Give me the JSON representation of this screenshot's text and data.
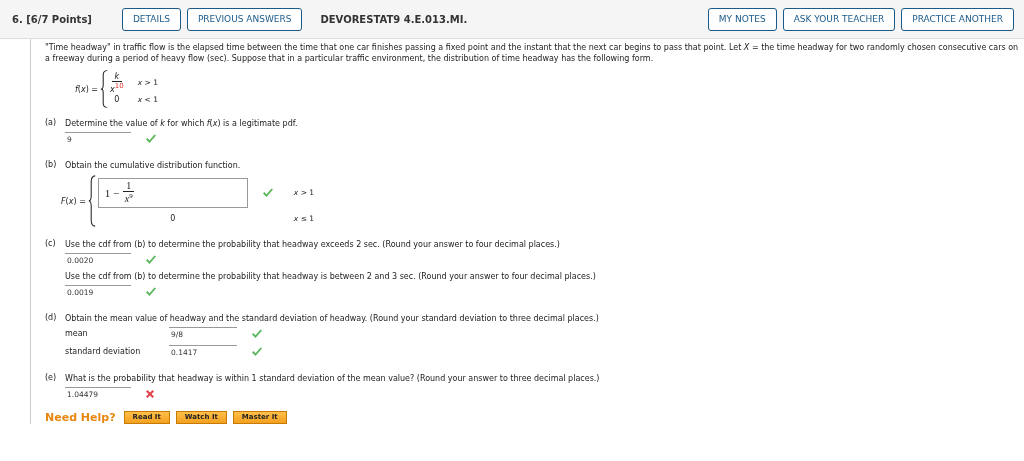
{
  "header": {
    "number": "6.",
    "points": "[6/7 Points]",
    "left_buttons": [
      "DETAILS",
      "PREVIOUS ANSWERS"
    ],
    "code": "DEVORESTAT9 4.E.013.MI.",
    "right_buttons": [
      "MY NOTES",
      "ASK YOUR TEACHER",
      "PRACTICE ANOTHER"
    ]
  },
  "intro": "\"Time headway\" in traffic flow is the elapsed time between the time that one car finishes passing a fixed point and the instant that the next car begins to pass that point. Let *X* = the time headway for two randomly chosen consecutive cars on a freeway during a period of heavy flow (sec). Suppose that in a particular traffic environment, the distribution of time headway has the following form.",
  "pdf": {
    "name": "*f*(*x*) =",
    "cases": [
      {
        "kind": "fraction",
        "numerator": "k",
        "base": "x",
        "exponent": "10",
        "condition": "*x* > 1"
      },
      {
        "kind": "value",
        "value": "0",
        "condition": "*x* < 1"
      }
    ]
  },
  "parts": [
    {
      "label": "(a)",
      "items": [
        {
          "kind": "question",
          "prompt": "Determine the value of *k* for which *f*(*x*) is a legitimate pdf.",
          "answers": [
            {
              "value": "9",
              "correct": true
            }
          ]
        }
      ]
    },
    {
      "label": "(b)",
      "items": [
        {
          "kind": "question",
          "prompt": "Obtain the cumulative distribution function."
        },
        {
          "kind": "cdf",
          "name": "*F*(*x*) =",
          "cases": [
            {
              "kind": "answer",
              "lead": "1 −",
              "numerator": "1",
              "base": "x",
              "exponent": "9",
              "condition": "*x* > 1",
              "correct": true
            },
            {
              "kind": "value",
              "value": "0",
              "condition": "*x* ≤ 1"
            }
          ]
        }
      ]
    },
    {
      "label": "(c)",
      "items": [
        {
          "kind": "question",
          "prompt": "Use the cdf from (b) to determine the probability that headway exceeds 2 sec. (Round your answer to four decimal places.)",
          "answers": [
            {
              "value": "0.0020",
              "correct": true
            }
          ]
        },
        {
          "kind": "question",
          "prompt": "Use the cdf from (b) to determine the probability that headway is between 2 and 3 sec. (Round your answer to four decimal places.)",
          "answers": [
            {
              "value": "0.0019",
              "correct": true
            }
          ]
        }
      ]
    },
    {
      "label": "(d)",
      "items": [
        {
          "kind": "question",
          "prompt": "Obtain the mean value of headway and the standard deviation of headway. (Round your standard deviation to three decimal places.)",
          "answers": [
            {
              "label": "mean",
              "value": "9/8",
              "correct": true
            },
            {
              "label": "standard deviation",
              "value": "0.1417",
              "correct": true
            }
          ]
        }
      ]
    },
    {
      "label": "(e)",
      "items": [
        {
          "kind": "question",
          "prompt": "What is the probability that headway is within 1 standard deviation of the mean value? (Round your answer to three decimal places.)",
          "answers": [
            {
              "value": "1.04479",
              "correct": false
            }
          ]
        }
      ]
    }
  ],
  "help": {
    "title": "Need Help?",
    "buttons": [
      "Read It",
      "Watch It",
      "Master It"
    ]
  }
}
